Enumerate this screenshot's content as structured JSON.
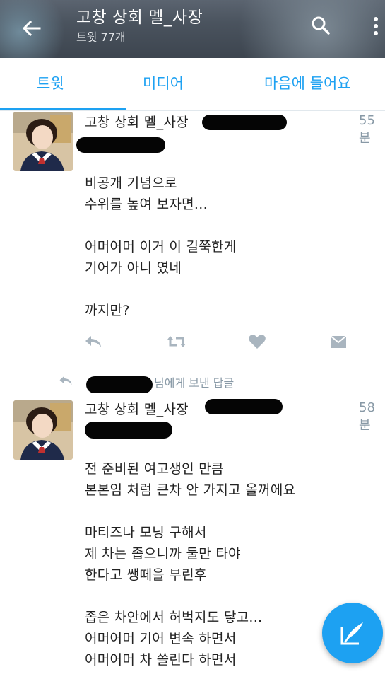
{
  "header": {
    "title": "고창 상회 멜_사장",
    "subtitle": "트윗 77개",
    "back_icon": "arrow-left-icon",
    "search_icon": "search-icon",
    "more_icon": "more-vertical-icon"
  },
  "tabs": [
    {
      "label": "트윗",
      "active": true
    },
    {
      "label": "미디어",
      "active": false
    },
    {
      "label": "마음에 들어요",
      "active": false
    }
  ],
  "tweets": [
    {
      "name": "고창 상회 멜_사장",
      "time": "55분",
      "lines": [
        "비공개 기념으로",
        "수위를 높여 보자면...",
        "",
        "어머어머 이거 이 길쭉한게",
        "기어가 아니 였네",
        "",
        "까지만?"
      ]
    },
    {
      "reply_context": "님에게 보낸 답글",
      "name": "고창 상회 멜_사장",
      "time": "58분",
      "lines": [
        "전 준비된 여고생인 만큼",
        "본본임 처럼 큰차 안 가지고 올꺼에요",
        "",
        "마티즈나 모닝 구해서",
        "제 차는 좁으니까 둘만 타야",
        "한다고 쌩떼을 부린후",
        "",
        "좁은 차안에서 허벅지도 닿고...",
        "어머어머 기어 변속 하면서",
        "어머어머 차 쏠린다 하면서"
      ]
    }
  ],
  "actions": [
    "reply-icon",
    "retweet-icon",
    "heart-icon",
    "message-icon"
  ],
  "colors": {
    "accent": "#1da1f2",
    "muted": "#8899a6"
  },
  "fab_icon": "compose-tweet-icon"
}
